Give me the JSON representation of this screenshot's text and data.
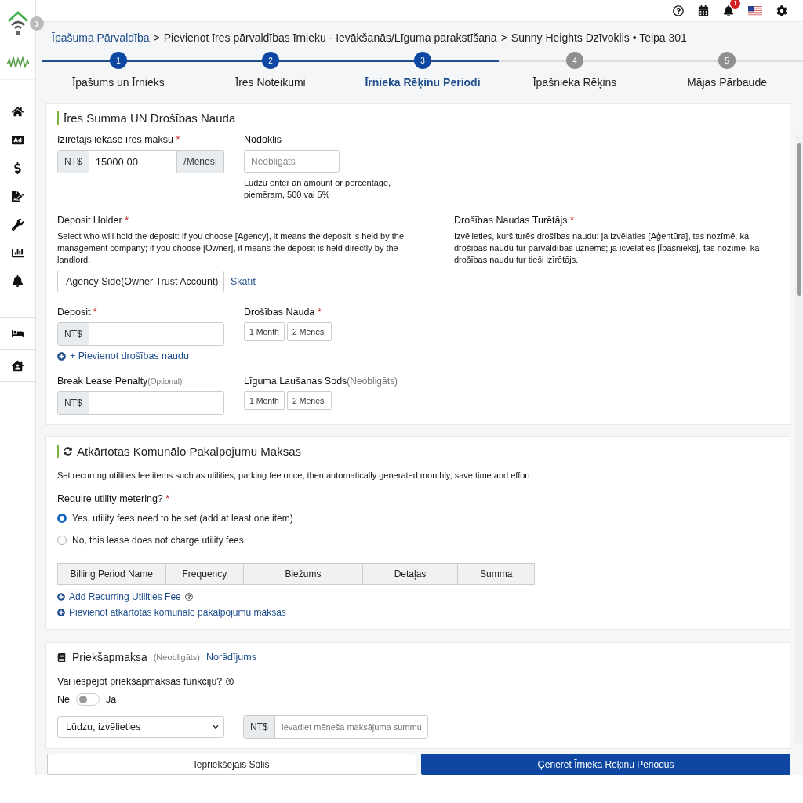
{
  "topbar": {
    "notification_count": "1"
  },
  "breadcrumb": {
    "separator": ">",
    "items": [
      {
        "text": "Īpašuma Pārvaldība",
        "link": true
      },
      {
        "text": "Pievienot īres pārvaldības īrnieku - Ievākšanās/Līguma parakstīšana",
        "link": false
      },
      {
        "text": "Sunny Heights Dzīvoklis • Telpa 301",
        "link": false
      }
    ]
  },
  "steps": [
    {
      "number": "1",
      "label": "Īpašums un Īrnieks",
      "reached": true,
      "selected": false
    },
    {
      "number": "2",
      "label": "Īres Noteikumi",
      "reached": true,
      "selected": false
    },
    {
      "number": "3",
      "label": "Īrnieka Rēķinu Periodi",
      "reached": true,
      "selected": true
    },
    {
      "number": "4",
      "label": "Īpašnieka Rēķins",
      "reached": false,
      "selected": false
    },
    {
      "number": "5",
      "label": "Mājas Pārbaude",
      "reached": false,
      "selected": false
    }
  ],
  "rent_section": {
    "title": "Īres Summa UN Drošības Nauda",
    "rent": {
      "label": "Izīrētājs iekasē īres maksu",
      "mark": "*",
      "prefix": "NT$",
      "value": "15000.00",
      "suffix": "/Mēnesī"
    },
    "tax": {
      "label": "Nodoklis",
      "placeholder": "Neobligāts",
      "help": "Lūdzu enter an amount or percentage, piemēram, 500 vai 5%"
    },
    "holder": {
      "label": "Deposit Holder",
      "mark": "*",
      "description": "Select who will hold the deposit: if you choose [Agency], it means the deposit is held by the management company; if you choose [Owner], it means the deposit is held directly by the landlord.",
      "value": "Agency Side(Owner Trust Account)",
      "link": "Skatīt"
    },
    "holder_lv": {
      "label": "Drošības Naudas Turētājs",
      "mark": "*",
      "description": "Izvēlieties, kurš turēs drošības naudu: ja izvēlaties [Aģentūra], tas nozīmē, ka drošības naudu tur pārvaldības uzņēms; ja icvēlaties [Īpašnieks], tas nozīmē, ka drošības naudu tur tieši izīrētājs."
    },
    "deposit": {
      "label": "Deposit",
      "mark": "*",
      "prefix": "NT$",
      "add_link": "+ Pievienot drošības naudu"
    },
    "deposit_lv": {
      "label": "Drošības Nauda",
      "mark": "*",
      "options": [
        {
          "label": "1 Month",
          "selected": false
        },
        {
          "label": "2 Mēneši",
          "selected": false
        }
      ]
    },
    "penalty": {
      "label": "Break Lease Penalty",
      "note": "(Optional)",
      "prefix": "NT$"
    },
    "penalty_lv": {
      "label": "Līguma Laušanas Sods",
      "note": "(Neobligāts)",
      "options": [
        {
          "label": "1 Month",
          "selected": false
        },
        {
          "label": "2 Mēneši",
          "selected": false
        }
      ]
    }
  },
  "utilities_section": {
    "title": "Atkārtotas Komunālo Pakalpojumu Maksas",
    "description": "Set recurring utilities fee items such as utilities, parking fee once, then automatically generated monthly, save time and effort",
    "question": "Require utility metering?",
    "mark": "*",
    "options": [
      {
        "label": "Yes, utility fees need to be set (add at least one item)",
        "selected": true
      },
      {
        "label": "No, this lease does not charge utility fees",
        "selected": false
      }
    ],
    "columns": [
      "Billing Period Name",
      "Frequency",
      "Biežums",
      "Detaļas",
      "Summa"
    ],
    "links": [
      {
        "text": "Add Recurring Utilities Fee",
        "help": true
      },
      {
        "text": "Pievienot atkartotas komunālo pakalpojumu maksas",
        "help": false
      }
    ]
  },
  "prepay_section": {
    "title": "Priekšapmaksa",
    "note": "(Neobligāts)",
    "link": "Norādījums",
    "question": "Vai iespējot priekšapmaksas funkciju?",
    "off_label": "Nē",
    "on_label": "Jā",
    "on": false,
    "select": "Lūdzu, izvēlieties",
    "prefix": "NT$",
    "placeholder": "Ievadiet mēneša maksājuma summu"
  },
  "buttons": {
    "previous": "Iepriekšējais Solis",
    "next": "Ģenerēt Īrnieka Rēķinu Periodus"
  }
}
